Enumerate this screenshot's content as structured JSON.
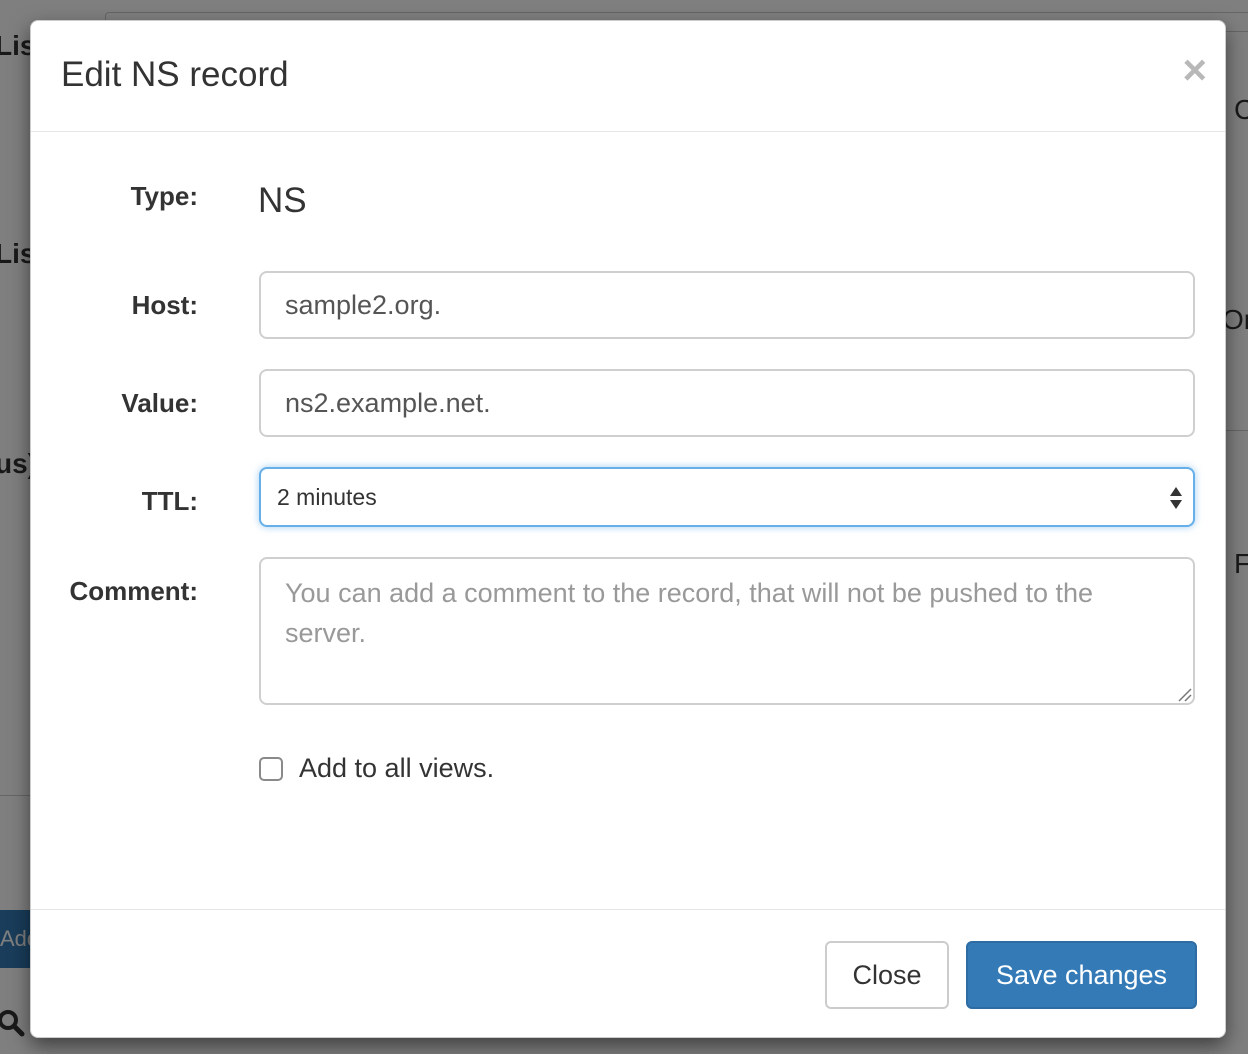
{
  "background": {
    "fragments": [
      "List",
      "List",
      "us)",
      "C",
      "On",
      "F",
      "Add"
    ]
  },
  "modal": {
    "title": "Edit NS record",
    "close_glyph": "×",
    "type": {
      "label": "Type:",
      "value": "NS"
    },
    "host": {
      "label": "Host:",
      "value": "sample2.org."
    },
    "value": {
      "label": "Value:",
      "value": "ns2.example.net."
    },
    "ttl": {
      "label": "TTL:",
      "selected": "2 minutes"
    },
    "comment": {
      "label": "Comment:",
      "placeholder": "You can add a comment to the record, that will not be pushed to the server."
    },
    "all_views": {
      "label": "Add to all views.",
      "checked": false
    },
    "buttons": {
      "close": "Close",
      "save": "Save changes"
    }
  },
  "colors": {
    "primary": "#337ab7",
    "focus_border": "#66afe9",
    "backdrop": "rgba(0,0,0,0.5)"
  },
  "icons": [
    "close-icon",
    "select-arrows-icon",
    "resize-grip-icon",
    "search-icon"
  ]
}
